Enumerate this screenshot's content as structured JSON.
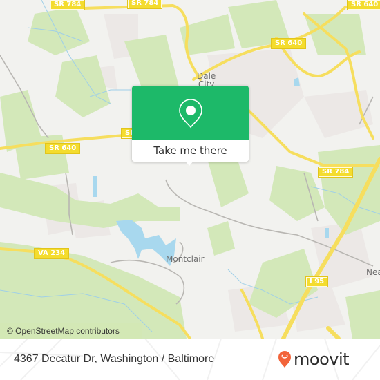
{
  "map": {
    "place_labels": [
      {
        "id": "dale-city",
        "text": "Dale\nCity"
      },
      {
        "id": "montclair",
        "text": "Montclair"
      },
      {
        "id": "nea",
        "text": "Nea"
      }
    ],
    "road_shields": [
      {
        "id": "sr784-a",
        "text": "SR 784"
      },
      {
        "id": "sr784-b",
        "text": "SR 784"
      },
      {
        "id": "sr640-a",
        "text": "SR 640"
      },
      {
        "id": "sr640-b",
        "text": "SR 640"
      },
      {
        "id": "sr640-c",
        "text": "SR 640"
      },
      {
        "id": "sr640-d",
        "text": "SR"
      },
      {
        "id": "sr784-c",
        "text": "SR 784"
      },
      {
        "id": "va234",
        "text": "VA 234"
      },
      {
        "id": "i95",
        "text": "I 95"
      }
    ],
    "attribution": "© OpenStreetMap contributors"
  },
  "callout": {
    "icon": "map-pin-icon",
    "button_label": "Take me there",
    "color": "#1db969"
  },
  "footer": {
    "address": "4367 Decatur Dr, Washington / Baltimore",
    "brand": "moovit",
    "brand_color": "#f2643a"
  }
}
